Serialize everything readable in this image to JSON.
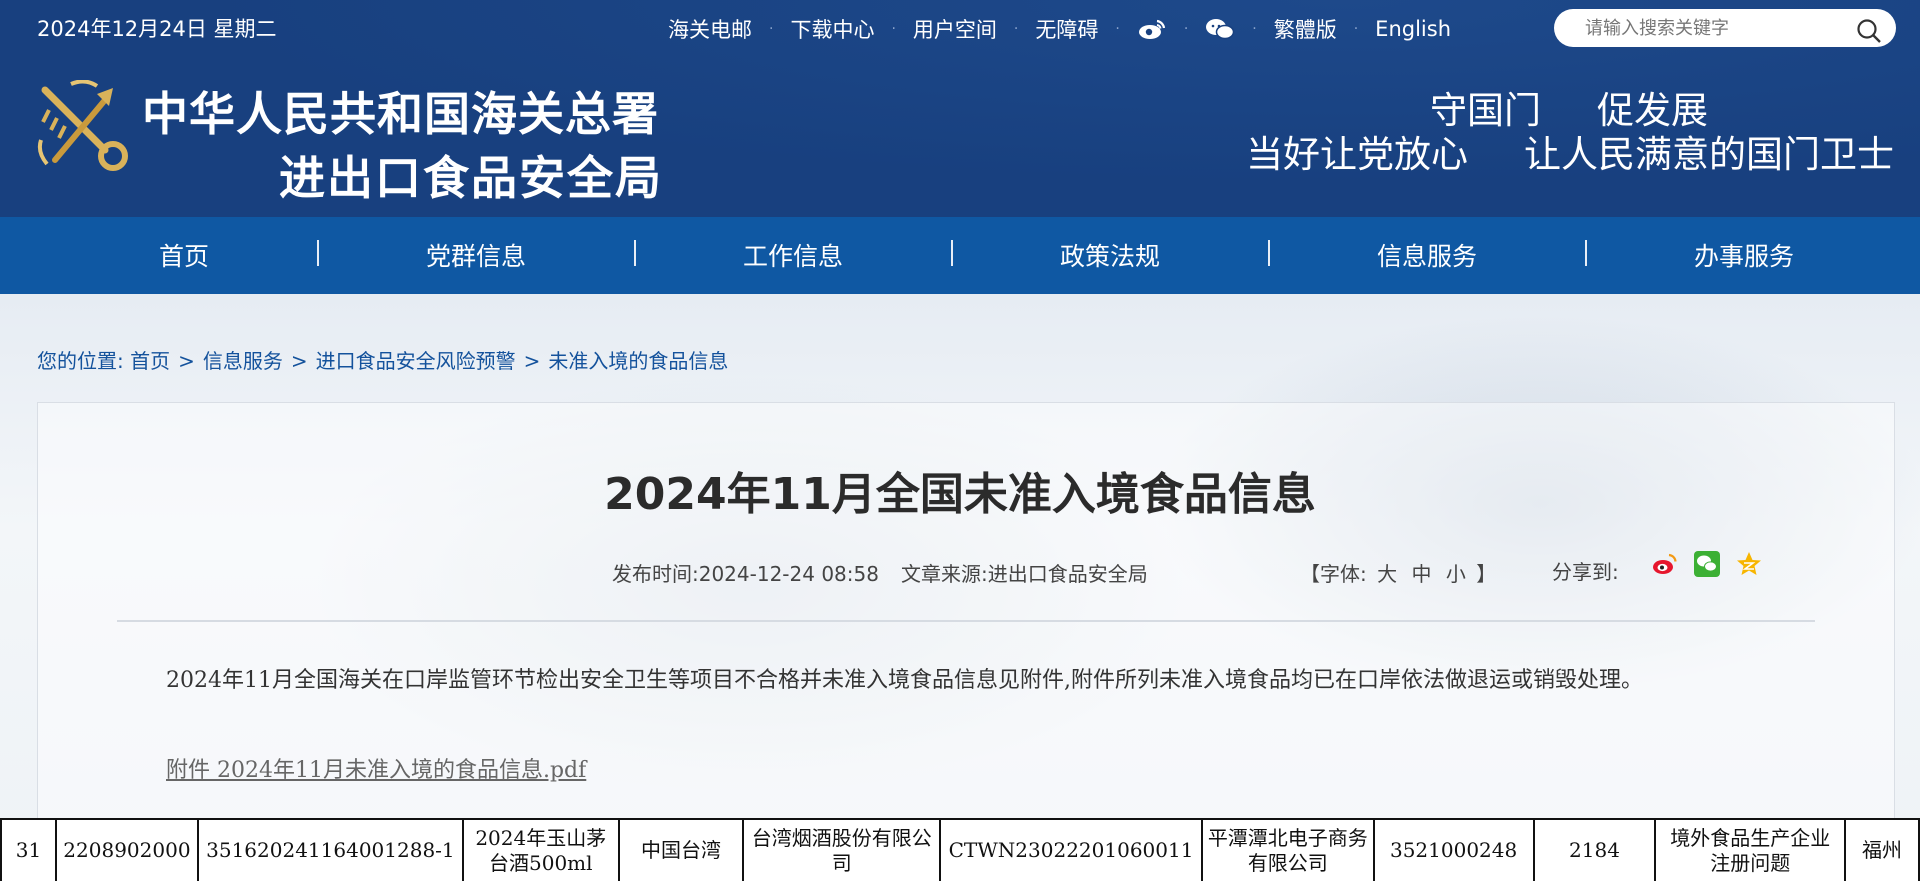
{
  "header": {
    "date": "2024年12月24日 星期二",
    "top_links": [
      "海关电邮",
      "下载中心",
      "用户空间",
      "无障碍"
    ],
    "lang_links": [
      "繁體版",
      "English"
    ],
    "search_placeholder": "请输入搜索关键字",
    "org_line1": "中华人民共和国海关总署",
    "org_line2": "进出口食品安全局",
    "slogan_line1": [
      "守国门",
      "促发展"
    ],
    "slogan_line2": [
      "当好让党放心",
      "让人民满意的国门卫士"
    ]
  },
  "nav": {
    "items": [
      "首页",
      "党群信息",
      "工作信息",
      "政策法规",
      "信息服务",
      "办事服务"
    ]
  },
  "breadcrumb": {
    "prefix": "您的位置:",
    "items": [
      "首页",
      "信息服务",
      "进口食品安全风险预警",
      "未准入境的食品信息"
    ]
  },
  "article": {
    "title": "2024年11月全国未准入境食品信息",
    "publish": "发布时间:2024-12-24 08:58",
    "source": "文章来源:进出口食品安全局",
    "font_label_open": "【字体:",
    "font_sizes": [
      "大",
      "中",
      "小"
    ],
    "font_label_close": "】",
    "share_label": "分享到:",
    "body": "2024年11月全国海关在口岸监管环节检出安全卫生等项目不合格并未准入境食品信息见附件,附件所列未准入境食品均已在口岸依法做退运或销毁处理。",
    "attachment": "附件 2024年11月未准入境的食品信息.pdf"
  },
  "table_row": [
    "31",
    "2208902000",
    "351620241164001288-1",
    "2024年玉山茅台酒500ml",
    "中国台湾",
    "台湾烟酒股份有限公司",
    "CTWN23022201060011",
    "平潭潭北电子商务有限公司",
    "3521000248",
    "2184",
    "境外食品生产企业注册问题",
    "福州"
  ],
  "colors": {
    "header_bg": "#18407f",
    "nav_bg": "#0f58a3",
    "link": "#14529c"
  }
}
